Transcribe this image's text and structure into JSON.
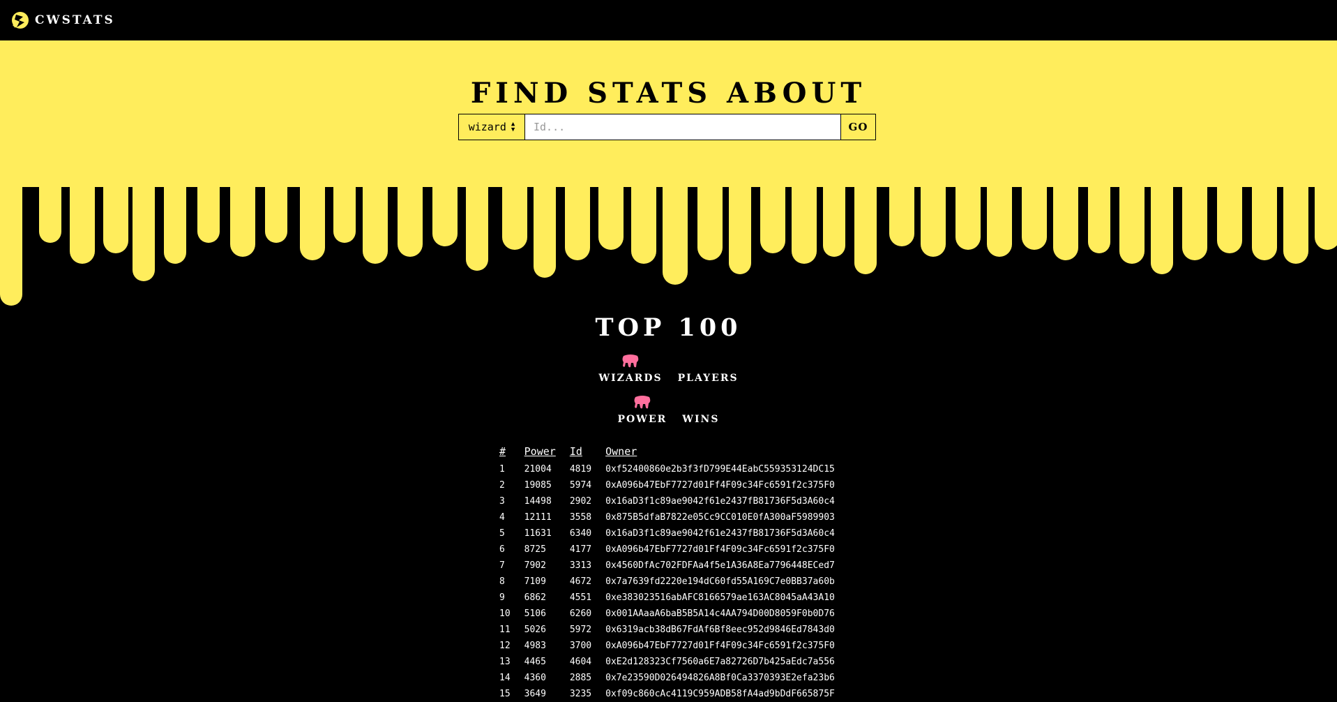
{
  "nav": {
    "brand": "CWSTATS"
  },
  "hero": {
    "title": "FIND STATS ABOUT",
    "select_value": "wizard",
    "input_placeholder": "Id...",
    "go_label": "GO"
  },
  "top": {
    "title": "TOP 100",
    "type_tabs": [
      {
        "label": "WIZARDS",
        "active": true
      },
      {
        "label": "PLAYERS",
        "active": false
      }
    ],
    "sort_tabs": [
      {
        "label": "POWER",
        "active": true
      },
      {
        "label": "WINS",
        "active": false
      }
    ]
  },
  "table": {
    "headers": [
      "#",
      "Power",
      "Id",
      "Owner"
    ],
    "rows": [
      [
        "1",
        "21004",
        "4819",
        "0xf52400860e2b3f3fD799E44EabC559353124DC15"
      ],
      [
        "2",
        "19085",
        "5974",
        "0xA096b47EbF7727d01Ff4F09c34Fc6591f2c375F0"
      ],
      [
        "3",
        "14498",
        "2902",
        "0x16aD3f1c89ae9042f61e2437fB81736F5d3A60c4"
      ],
      [
        "4",
        "12111",
        "3558",
        "0x875B5dfaB7822e05Cc9CC010E0fA300aF5989903"
      ],
      [
        "5",
        "11631",
        "6340",
        "0x16aD3f1c89ae9042f61e2437fB81736F5d3A60c4"
      ],
      [
        "6",
        "8725",
        "4177",
        "0xA096b47EbF7727d01Ff4F09c34Fc6591f2c375F0"
      ],
      [
        "7",
        "7902",
        "3313",
        "0x4560DfAc702FDFAa4f5e1A36A8Ea7796448ECed7"
      ],
      [
        "8",
        "7109",
        "4672",
        "0x7a7639fd2220e194dC60fd55A169C7e0BB37a60b"
      ],
      [
        "9",
        "6862",
        "4551",
        "0xe383023516abAFC8166579ae163AC8045aA43A10"
      ],
      [
        "10",
        "5106",
        "6260",
        "0x001AAaaA6baB5B5A14c4AA794D00D8059F0b0D76"
      ],
      [
        "11",
        "5026",
        "5972",
        "0x6319acb38dB67FdAf6Bf8eec952d9846Ed7843d0"
      ],
      [
        "12",
        "4983",
        "3700",
        "0xA096b47EbF7727d01Ff4F09c34Fc6591f2c375F0"
      ],
      [
        "13",
        "4465",
        "4604",
        "0xE2d128323Cf7560a6E7a82726D7b425aEdc7a556"
      ],
      [
        "14",
        "4360",
        "2885",
        "0x7e23590D026494826A8Bf0Ca3370393E2efa23b6"
      ],
      [
        "15",
        "3649",
        "3235",
        "0xf09c860cAc4119C959ADB58fA4ad9bDdF665875F"
      ]
    ]
  },
  "colors": {
    "yellow": "#ffed5c",
    "black": "#000000",
    "pink": "#ff6f9d"
  }
}
